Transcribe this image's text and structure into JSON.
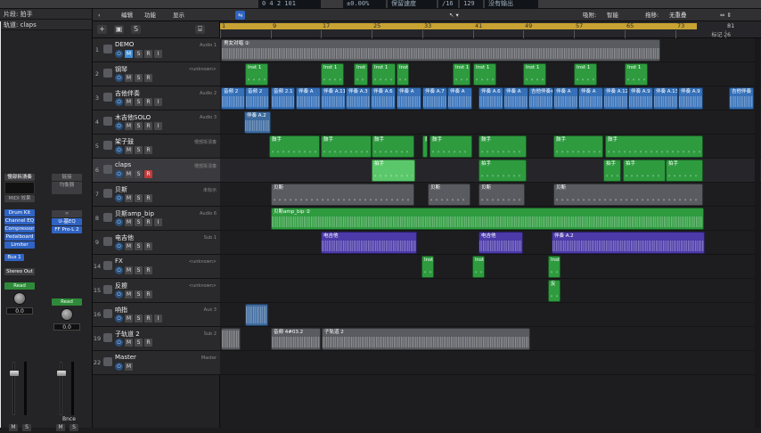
{
  "topbar": {
    "lcd_position": "0  4  2  101",
    "lcd_percent": "±0.00%",
    "lcd_mode": "保留速度",
    "lcd_division": "/16",
    "lcd_tempo": "129",
    "lcd_output": "没有输出"
  },
  "inspector": {
    "region_label": "片段: 拍手",
    "track_label": "轨道: claps",
    "strip1": {
      "name": "慢部拆溃奏",
      "eq_label": "EQ",
      "midi_fx": "MIDI 效果",
      "slots": [
        "Drum Kit",
        "Channel EQ",
        "Compressor",
        "Pedalboard",
        "Limiter"
      ],
      "bus": "Bus 1",
      "output": "Stereo Out",
      "read": "Read",
      "value": "0.0",
      "m": "M",
      "s": "S"
    },
    "strip2": {
      "name": "链接",
      "eq_label": "均衡器",
      "slots": [
        "U-基EQ",
        "FF Pro-L 2"
      ],
      "read": "Read",
      "value": "0.0",
      "m": "M",
      "s": "S",
      "bottom_name": "Bnce"
    }
  },
  "header": {
    "edit": "编辑",
    "functions": "功能",
    "view": "显示",
    "snap_label": "吸附:",
    "snap_value": "智能",
    "drag_label": "拖移:",
    "drag_value": "无重叠"
  },
  "ruler": {
    "bars": [
      "1",
      "9",
      "17",
      "25",
      "33",
      "41",
      "49",
      "57",
      "65",
      "73",
      "81"
    ],
    "marker": "标记 26"
  },
  "tracks": [
    {
      "num": "1",
      "name": "DEMO",
      "plug": "Audio 1",
      "m_on": true,
      "s": true,
      "r": true,
      "i": true,
      "r_on": false
    },
    {
      "num": "2",
      "name": "钢琴",
      "plug": "<unknown>",
      "m_on": false,
      "s": true,
      "r": true,
      "i": false,
      "r_on": false
    },
    {
      "num": "3",
      "name": "吉他伴奏",
      "plug": "Audio 2",
      "m_on": false,
      "s": true,
      "r": true,
      "i": true,
      "r_on": false
    },
    {
      "num": "4",
      "name": "木吉他SOLO",
      "plug": "Audio 3",
      "m_on": false,
      "s": true,
      "r": true,
      "i": true,
      "r_on": false
    },
    {
      "num": "5",
      "name": "架子鼓",
      "plug": "慢部拆溃奏",
      "m_on": false,
      "s": true,
      "r": true,
      "i": false,
      "r_on": false
    },
    {
      "num": "6",
      "name": "claps",
      "plug": "慢部拆溃奏",
      "m_on": false,
      "s": true,
      "r": true,
      "i": false,
      "r_on": true
    },
    {
      "num": "7",
      "name": "贝斯",
      "plug": "未标示",
      "m_on": false,
      "s": true,
      "r": true,
      "i": false,
      "r_on": false
    },
    {
      "num": "8",
      "name": "贝斯amp_bip",
      "plug": "Audio 6",
      "m_on": false,
      "s": true,
      "r": true,
      "i": true,
      "r_on": false
    },
    {
      "num": "9",
      "name": "电吉他",
      "plug": "Sub 1",
      "m_on": false,
      "s": true,
      "r": true,
      "i": false,
      "r_on": false
    },
    {
      "num": "14",
      "name": "FX",
      "plug": "<unknown>",
      "m_on": false,
      "s": true,
      "r": true,
      "i": false,
      "r_on": false
    },
    {
      "num": "15",
      "name": "反擦",
      "plug": "<unknown>",
      "m_on": false,
      "s": true,
      "r": true,
      "i": false,
      "r_on": false
    },
    {
      "num": "16",
      "name": "响指",
      "plug": "Aux 3",
      "m_on": false,
      "s": true,
      "r": true,
      "i": true,
      "r_on": false
    },
    {
      "num": "19",
      "name": "子轨道 2",
      "plug": "Sub 2",
      "m_on": false,
      "s": true,
      "r": true,
      "i": false,
      "r_on": false
    },
    {
      "num": "22",
      "name": "Master",
      "plug": "Master",
      "m_on": false,
      "s": false,
      "r": false,
      "i": false,
      "r_on": false
    }
  ],
  "regions": {
    "demo": [
      {
        "label": "男女对唱 ②"
      }
    ],
    "piano": [
      {
        "label": "Inst 1"
      },
      {
        "label": "Inst 1"
      },
      {
        "label": "Inst 1"
      },
      {
        "label": "Inst 1"
      },
      {
        "label": "Inst 1"
      },
      {
        "label": "Inst 1"
      },
      {
        "label": "Inst 1"
      },
      {
        "label": "Inst 1"
      },
      {
        "label": "Inst 1"
      },
      {
        "label": "Inst 1"
      }
    ],
    "guitar": [
      {
        "label": "音频 2"
      },
      {
        "label": "音频 2"
      },
      {
        "label": "音频 2.1"
      },
      {
        "label": "伴奏 A"
      },
      {
        "label": "伴奏 A.11"
      },
      {
        "label": "伴奏 A.3"
      },
      {
        "label": "伴奏 A.6"
      },
      {
        "label": "伴奏 A"
      },
      {
        "label": "伴奏 A.7"
      },
      {
        "label": "伴奏 A"
      },
      {
        "label": "伴奏 A.6"
      },
      {
        "label": "伴奏 A"
      },
      {
        "label": "吉他伴奏#"
      },
      {
        "label": "伴奏 A"
      },
      {
        "label": "伴奏 A"
      },
      {
        "label": "伴奏 A.12"
      },
      {
        "label": "伴奏 A.9"
      },
      {
        "label": "伴奏 A.13"
      },
      {
        "label": "伴奏 A.9"
      },
      {
        "label": "吉他伴奏"
      }
    ],
    "solo": [
      {
        "label": "伴奏 A.2"
      }
    ],
    "drums": [
      {
        "label": "鼓手"
      },
      {
        "label": "鼓手"
      },
      {
        "label": "鼓手"
      },
      {
        "label": "鼓手"
      },
      {
        "label": "鼓手"
      },
      {
        "label": "鼓手"
      },
      {
        "label": "鼓手"
      },
      {
        "label": "鼓手"
      }
    ],
    "claps": [
      {
        "label": "拍手"
      },
      {
        "label": "拍手"
      },
      {
        "label": "拍手"
      },
      {
        "label": "拍手"
      },
      {
        "label": "拍手"
      }
    ],
    "bass": [
      {
        "label": "贝斯"
      },
      {
        "label": "贝斯"
      },
      {
        "label": "贝斯"
      },
      {
        "label": "贝斯"
      }
    ],
    "bassamp": [
      {
        "label": "贝斯amp_bip ②"
      }
    ],
    "eguitar": [
      {
        "label": "电吉他"
      },
      {
        "label": "电吉他"
      },
      {
        "label": "伴奏 A.2"
      }
    ],
    "fx": [
      {
        "label": "Inst"
      },
      {
        "label": "Inst"
      },
      {
        "label": "Inst"
      }
    ],
    "reverse": [
      {
        "label": "反"
      }
    ],
    "sub2": [
      {
        "label": "音频 4#03.2"
      },
      {
        "label": "子轨道 2"
      }
    ]
  }
}
